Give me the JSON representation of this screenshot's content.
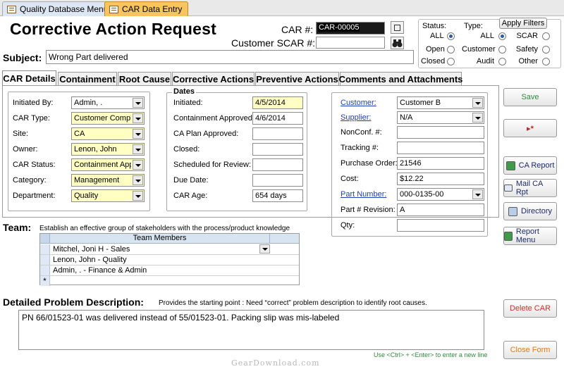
{
  "doc_tabs": [
    {
      "label": "Quality Database Menu"
    },
    {
      "label": "CAR Data Entry"
    }
  ],
  "title": "Corrective Action Request",
  "car_number": {
    "label": "CAR #:",
    "value": "CAR-00005"
  },
  "customer_scar": {
    "label": "Customer SCAR #:",
    "value": ""
  },
  "subject": {
    "label": "Subject:",
    "value": "Wrong Part delivered"
  },
  "status_filter": {
    "label": "Status:",
    "options": [
      {
        "label": "ALL",
        "selected": true
      },
      {
        "label": "Open",
        "selected": false
      },
      {
        "label": "Closed",
        "selected": false
      }
    ]
  },
  "type_filter": {
    "label": "Type:",
    "apply_label": "Apply Filters",
    "options_left": [
      {
        "label": "ALL",
        "selected": true
      },
      {
        "label": "Customer",
        "selected": false
      },
      {
        "label": "Audit",
        "selected": false
      }
    ],
    "options_right": [
      {
        "label": "SCAR",
        "selected": false
      },
      {
        "label": "Safety",
        "selected": false
      },
      {
        "label": "Other",
        "selected": false
      }
    ]
  },
  "form_tabs": [
    {
      "label": "CAR Details"
    },
    {
      "label": "Containment"
    },
    {
      "label": "Root Cause"
    },
    {
      "label": "Corrective Actions"
    },
    {
      "label": "Preventive Actions"
    },
    {
      "label": "Comments and Attachments"
    }
  ],
  "details": {
    "initiated_by": {
      "label": "Initiated By:",
      "value": "Admin, ."
    },
    "car_type": {
      "label": "CAR Type:",
      "value": "Customer Complain"
    },
    "site": {
      "label": "Site:",
      "value": "CA"
    },
    "owner": {
      "label": "Owner:",
      "value": "Lenon, John"
    },
    "car_status": {
      "label": "CAR Status:",
      "value": "Containment Appro"
    },
    "category": {
      "label": "Category:",
      "value": "Management"
    },
    "department": {
      "label": "Department:",
      "value": "Quality"
    }
  },
  "dates": {
    "title": "Dates",
    "initiated": {
      "label": "Initiated:",
      "value": "4/5/2014"
    },
    "containment_approved": {
      "label": "Containment Approved:",
      "value": "4/6/2014"
    },
    "ca_plan_approved": {
      "label": "CA Plan Approved:",
      "value": ""
    },
    "closed": {
      "label": "Closed:",
      "value": ""
    },
    "scheduled_review": {
      "label": "Scheduled for Review:",
      "value": ""
    },
    "due_date": {
      "label": "Due Date:",
      "value": ""
    },
    "car_age": {
      "label": "CAR Age:",
      "value": "654 days"
    }
  },
  "customer_info": {
    "customer": {
      "label": "Customer:",
      "value": "Customer B"
    },
    "supplier": {
      "label": "Supplier:",
      "value": "N/A"
    },
    "nonconf": {
      "label": "NonConf. #:",
      "value": ""
    },
    "tracking": {
      "label": "Tracking #:",
      "value": ""
    },
    "purchase_order": {
      "label": "Purchase Order:",
      "value": "21546"
    },
    "cost": {
      "label": "Cost:",
      "value": "$12.22"
    },
    "part_number": {
      "label": "Part Number:",
      "value": "000-0135-00"
    },
    "part_revision": {
      "label": "Part # Revision:",
      "value": "A"
    },
    "qty": {
      "label": "Qty:",
      "value": ""
    }
  },
  "team": {
    "label": "Team:",
    "hint": "Establish an effective group of stakeholders with the process/product knowledge",
    "column_header": "Team Members",
    "members": [
      "Mitchel, Joni H - Sales",
      "Lenon, John  - Quality",
      "Admin, .  - Finance & Admin"
    ],
    "new_row_marker": "*"
  },
  "problem": {
    "label": "Detailed Problem Description:",
    "hint": "Provides the starting point : Need “correct” problem description to identify root causes.",
    "value": "PN 66/01523-01 was delivered instead of 55/01523-01.  Packing slip was mis-labeled",
    "newline_hint": "Use <Ctrl> + <Enter> to enter a new line"
  },
  "side_buttons": {
    "save": "Save",
    "new_record": "▸*",
    "ca_report": "CA Report",
    "mail_ca_rpt": "Mail CA Rpt",
    "directory": "Directory",
    "report_menu": "Report Menu",
    "delete_car": "Delete CAR",
    "close_form": "Close Form"
  },
  "watermark": "GearDownload.com"
}
